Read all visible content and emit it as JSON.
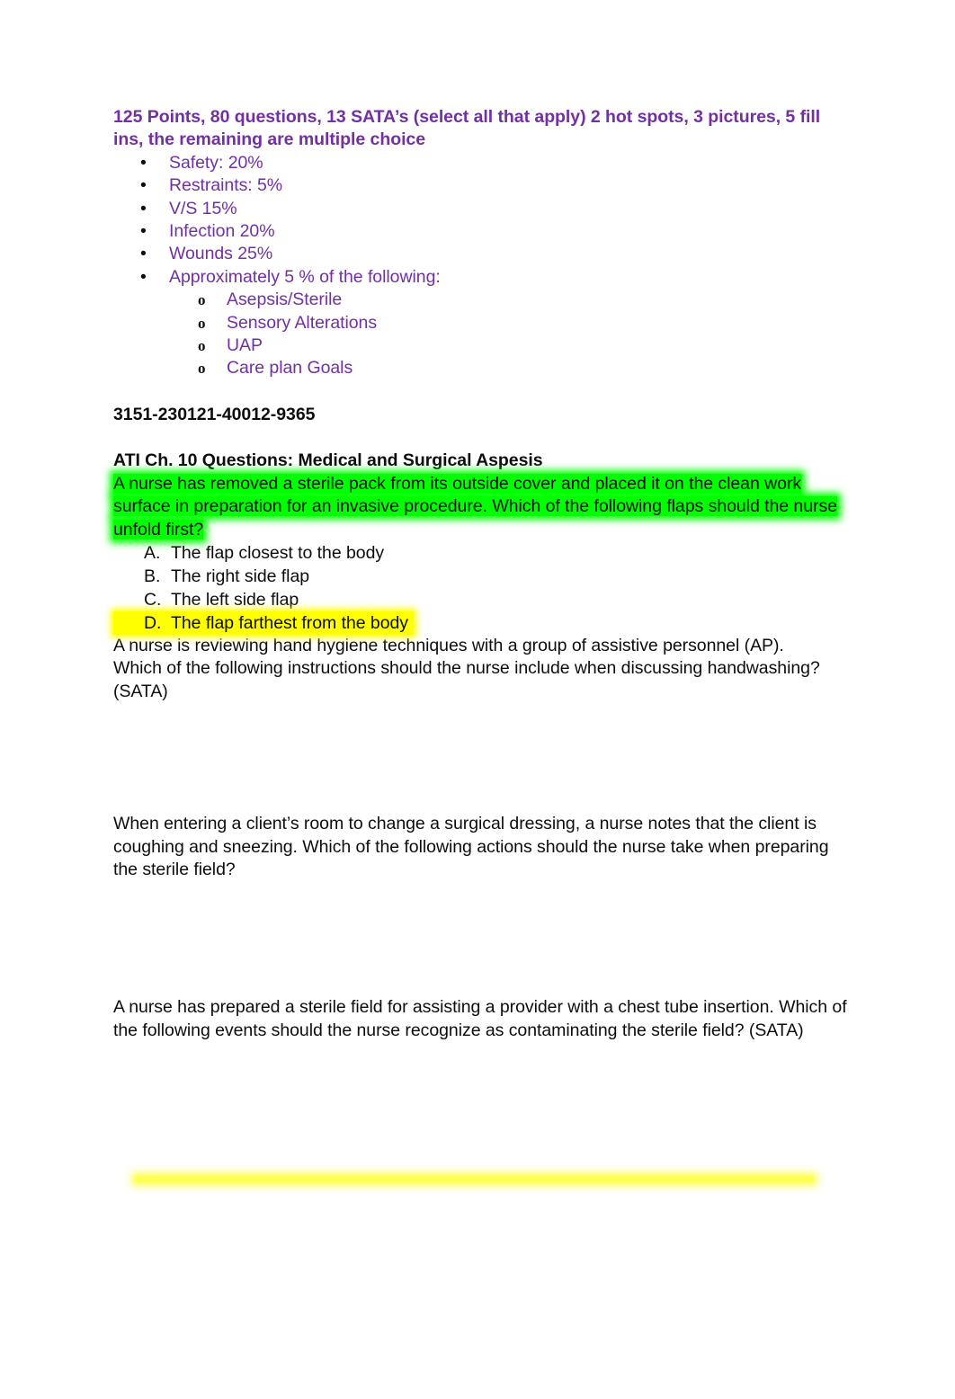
{
  "document": {
    "intro_heading": "125 Points, 80 questions, 13 SATA’s (select all that apply) 2 hot spots, 3 pictures, 5 fill ins, the remaining are multiple choice",
    "topic_bullets": [
      {
        "marker": "•",
        "label": "Safety:  20%"
      },
      {
        "marker": "•",
        "label": "Restraints: 5%"
      },
      {
        "marker": "•",
        "label": "V/S 15%"
      },
      {
        "marker": "•",
        "label": "Infection 20%"
      },
      {
        "marker": "•",
        "label": "Wounds 25%"
      },
      {
        "marker": "•",
        "label": "Approximately 5 % of the following:"
      }
    ],
    "sub_bullets": [
      {
        "marker": "o",
        "label": "Asepsis/Sterile"
      },
      {
        "marker": "o",
        "label": "Sensory Alterations"
      },
      {
        "marker": "o",
        "label": "UAP"
      },
      {
        "marker": "o",
        "label": "Care plan Goals"
      }
    ],
    "reference_code": "3151-230121-40012-9365",
    "section_heading": "ATI Ch. 10 Questions: Medical and Surgical Aspesis",
    "question_1": {
      "line_1": "A nurse has removed a sterile pack from its outside cover and placed it on the clean work",
      "line_2": "surface in preparation for an invasive procedure.  Which of the following flaps should the nurse",
      "line_3": "unfold first?",
      "highlight_color": "#00ff00",
      "choices": [
        {
          "marker": "A.",
          "text": "The flap closest to the body",
          "highlighted": false
        },
        {
          "marker": "B.",
          "text": "The right side flap",
          "highlighted": false
        },
        {
          "marker": "C.",
          "text": "The left side flap",
          "highlighted": false
        },
        {
          "marker": "D.",
          "text": "The flap farthest from the body",
          "highlighted": true
        }
      ],
      "answer_highlight_color": "#ffff00"
    },
    "question_2": "A nurse is reviewing hand hygiene techniques with a group of assistive personnel (AP).  Which of the following instructions should the nurse include when discussing handwashing? (SATA)",
    "question_3": "When entering a client’s room to change a surgical dressing, a nurse notes that the client is coughing and sneezing.  Which of the following actions should the nurse take when preparing the sterile field?",
    "question_4": "A nurse has prepared a sterile field for assisting a provider with a chest tube insertion.  Which of the following events should the nurse recognize as contaminating the sterile field? (SATA)",
    "trailing_highlight_color": "#ffff00",
    "text_color": "#0d0d0d",
    "accent_color": "#7230a3"
  }
}
